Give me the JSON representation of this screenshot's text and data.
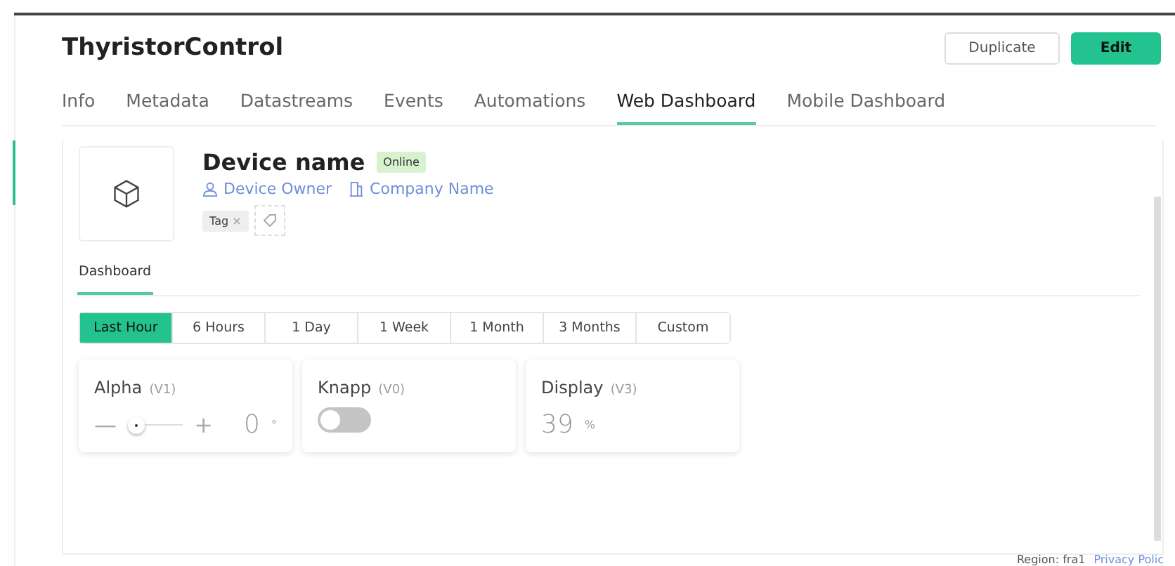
{
  "header": {
    "title": "ThyristorControl",
    "buttons": [
      {
        "label": "Duplicate",
        "kind": "secondary"
      },
      {
        "label": "Edit",
        "kind": "primary"
      }
    ]
  },
  "tabs": [
    {
      "label": "Info",
      "selected": false
    },
    {
      "label": "Metadata",
      "selected": false
    },
    {
      "label": "Datastreams",
      "selected": false
    },
    {
      "label": "Events",
      "selected": false
    },
    {
      "label": "Automations",
      "selected": false
    },
    {
      "label": "Web Dashboard",
      "selected": true
    },
    {
      "label": "Mobile Dashboard",
      "selected": false
    }
  ],
  "device": {
    "name": "Device name",
    "status": "Online",
    "owner": "Device Owner",
    "company": "Company Name",
    "tags": [
      {
        "label": "Tag",
        "remove": "×"
      }
    ]
  },
  "subtabs": [
    {
      "label": "Dashboard",
      "selected": true
    }
  ],
  "ranges": [
    {
      "label": "Last Hour",
      "selected": true
    },
    {
      "label": "6 Hours",
      "selected": false
    },
    {
      "label": "1 Day",
      "selected": false
    },
    {
      "label": "1 Week",
      "selected": false
    },
    {
      "label": "1 Month",
      "selected": false
    },
    {
      "label": "3 Months",
      "selected": false
    },
    {
      "label": "Custom",
      "selected": false
    }
  ],
  "widgets": [
    {
      "kind": "slider",
      "title": "Alpha",
      "pin": "(V1)",
      "level": 0.0,
      "minus": "—",
      "plus": "+",
      "value": "0",
      "unit": "°"
    },
    {
      "kind": "switch",
      "title": "Knapp",
      "pin": "(V0)",
      "on": false
    },
    {
      "kind": "display",
      "title": "Display",
      "pin": "(V3)",
      "value": "39",
      "unit": "%"
    }
  ],
  "footer": {
    "region": "Region: fra1",
    "link": "Privacy Polic"
  }
}
